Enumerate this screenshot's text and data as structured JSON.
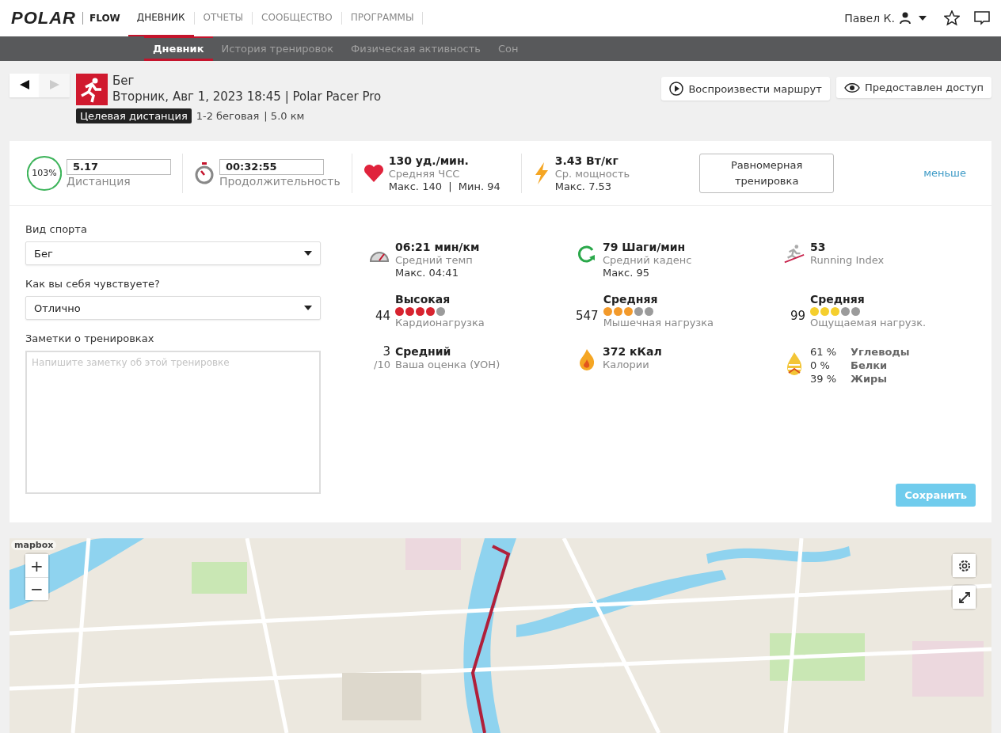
{
  "topbar": {
    "brand": "POLAR",
    "product": "FLOW",
    "tabs": [
      {
        "label": "ДНЕВНИК",
        "selected": true
      },
      {
        "label": "ОТЧЕТЫ",
        "selected": false
      },
      {
        "label": "СООБЩЕСТВО",
        "selected": false
      },
      {
        "label": "ПРОГРАММЫ",
        "selected": false
      }
    ],
    "user": "Павел К."
  },
  "subnav": [
    {
      "label": "Дневник",
      "selected": true
    },
    {
      "label": "История тренировок",
      "selected": false
    },
    {
      "label": "Физическая активность",
      "selected": false
    },
    {
      "label": "Сон",
      "selected": false
    }
  ],
  "session": {
    "prev_disabled": false,
    "next_disabled": true,
    "sport": "Бег",
    "subtitle": "Вторник, Авг 1, 2023 18:45 | Polar Pacer Pro",
    "target_badge": "Целевая дистанция",
    "target_name": "1-2 беговая",
    "target_distance": "| 5.0 км",
    "actions": [
      {
        "kind": "play",
        "label": "Воспроизвести маршрут"
      },
      {
        "kind": "share",
        "label": "Предоставлен доступ"
      }
    ]
  },
  "summary": {
    "distance": {
      "percent": "103%",
      "level": 1,
      "value": "5.17",
      "label": "Дистанция"
    },
    "duration": {
      "value": "00:32:55",
      "label": "Продолжительность"
    },
    "heart_rate": {
      "value": "130 уд./мин.",
      "label": "Средняя ЧСС",
      "detail": "Макс. 140  |  Мин. 94"
    },
    "power": {
      "value": "3.43 Вт/кг",
      "label": "Ср. мощность",
      "detail": "Макс. 7.53"
    },
    "training_type": "Равномерная тренировка",
    "less_link": "меньше"
  },
  "form": {
    "sport_label": "Вид спорта",
    "sport_value": "Бег",
    "feeling_label": "Как вы себя чувствуете?",
    "feeling_value": "Отлично",
    "notes_label": "Заметки о тренировках",
    "notes_placeholder": "Напишите заметку об этой тренировке",
    "save": "Сохранить",
    "save_disabled": true
  },
  "metrics": [
    {
      "kind": "pace",
      "value": "06:21 мин/км",
      "label": "Средний темп",
      "detail": "Макс. 04:41"
    },
    {
      "kind": "cadence",
      "value": "79 Шаги/мин",
      "label": "Средний каденс",
      "detail": "Макс. 95"
    },
    {
      "kind": "running_index",
      "value": "53",
      "label": "Running Index"
    },
    {
      "kind": "load",
      "number": "44",
      "value": "Высокая",
      "stars": 4,
      "color": "#d7232f",
      "label": "Кардионагрузка"
    },
    {
      "kind": "load",
      "number": "547",
      "value": "Средняя",
      "stars": 3,
      "color": "#f39a2b",
      "label": "Мышечная нагрузка"
    },
    {
      "kind": "load",
      "number": "99",
      "value": "Средняя",
      "stars": 3,
      "color": "#f5cf2e",
      "label": "Ощущаемая нагрузк."
    },
    {
      "kind": "rating",
      "number": "3",
      "scale": "/10",
      "value": "Средний",
      "label": "Ваша оценка (УОН)"
    },
    {
      "kind": "calories",
      "value": "372 кКал",
      "label": "Калории"
    },
    {
      "kind": "fuel",
      "rows": [
        {
          "percent": "61 %",
          "label": "Углеводы"
        },
        {
          "percent": "0 %",
          "label": "Белки"
        },
        {
          "percent": "39 %",
          "label": "Жиры"
        }
      ]
    }
  ],
  "map": {
    "kind": "picture",
    "attribution": "mapbox",
    "zoom_in": "+",
    "zoom_out": "−"
  }
}
